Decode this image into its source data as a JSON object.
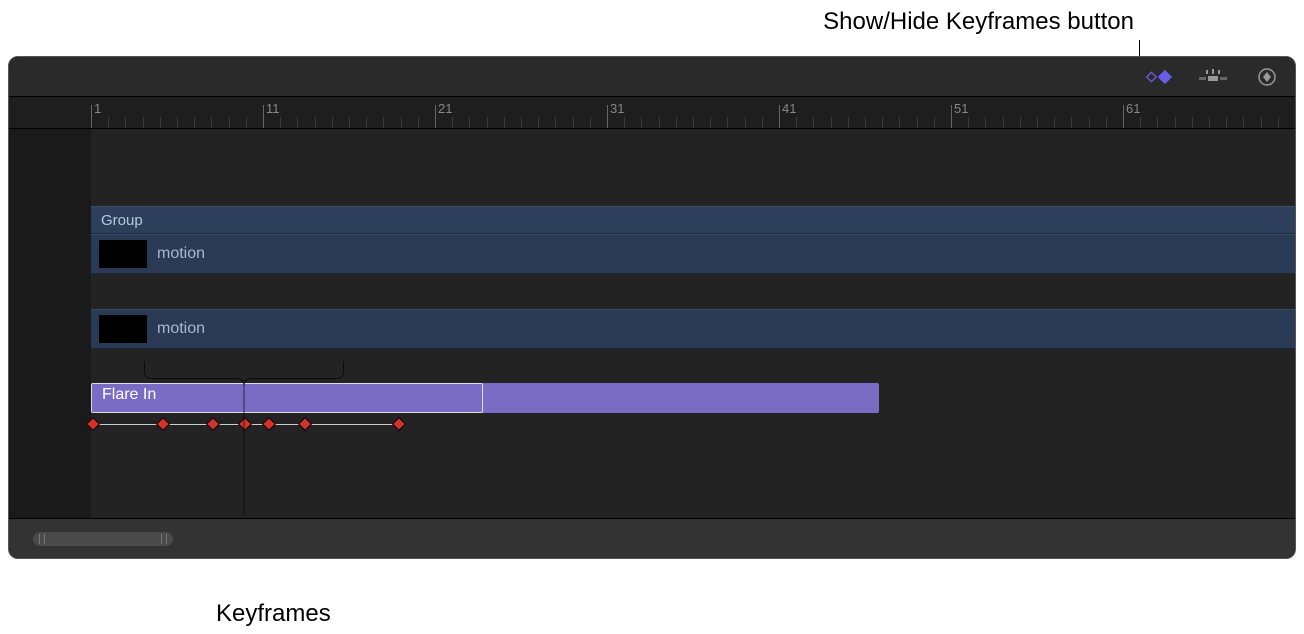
{
  "annotations": {
    "top": "Show/Hide Keyframes button",
    "bottom": "Keyframes"
  },
  "ruler": {
    "majors": [
      {
        "label": "1",
        "pos": 82
      },
      {
        "label": "11",
        "pos": 254
      },
      {
        "label": "21",
        "pos": 426
      },
      {
        "label": "31",
        "pos": 598
      },
      {
        "label": "41",
        "pos": 770
      },
      {
        "label": "51",
        "pos": 942
      },
      {
        "label": "61",
        "pos": 1114
      }
    ]
  },
  "tracks": {
    "group_label": "Group",
    "clip1_label": "motion",
    "clip2_label": "motion",
    "behavior_label": "Flare In"
  },
  "keyframes": [
    0,
    70,
    120,
    152,
    176,
    212,
    306
  ]
}
